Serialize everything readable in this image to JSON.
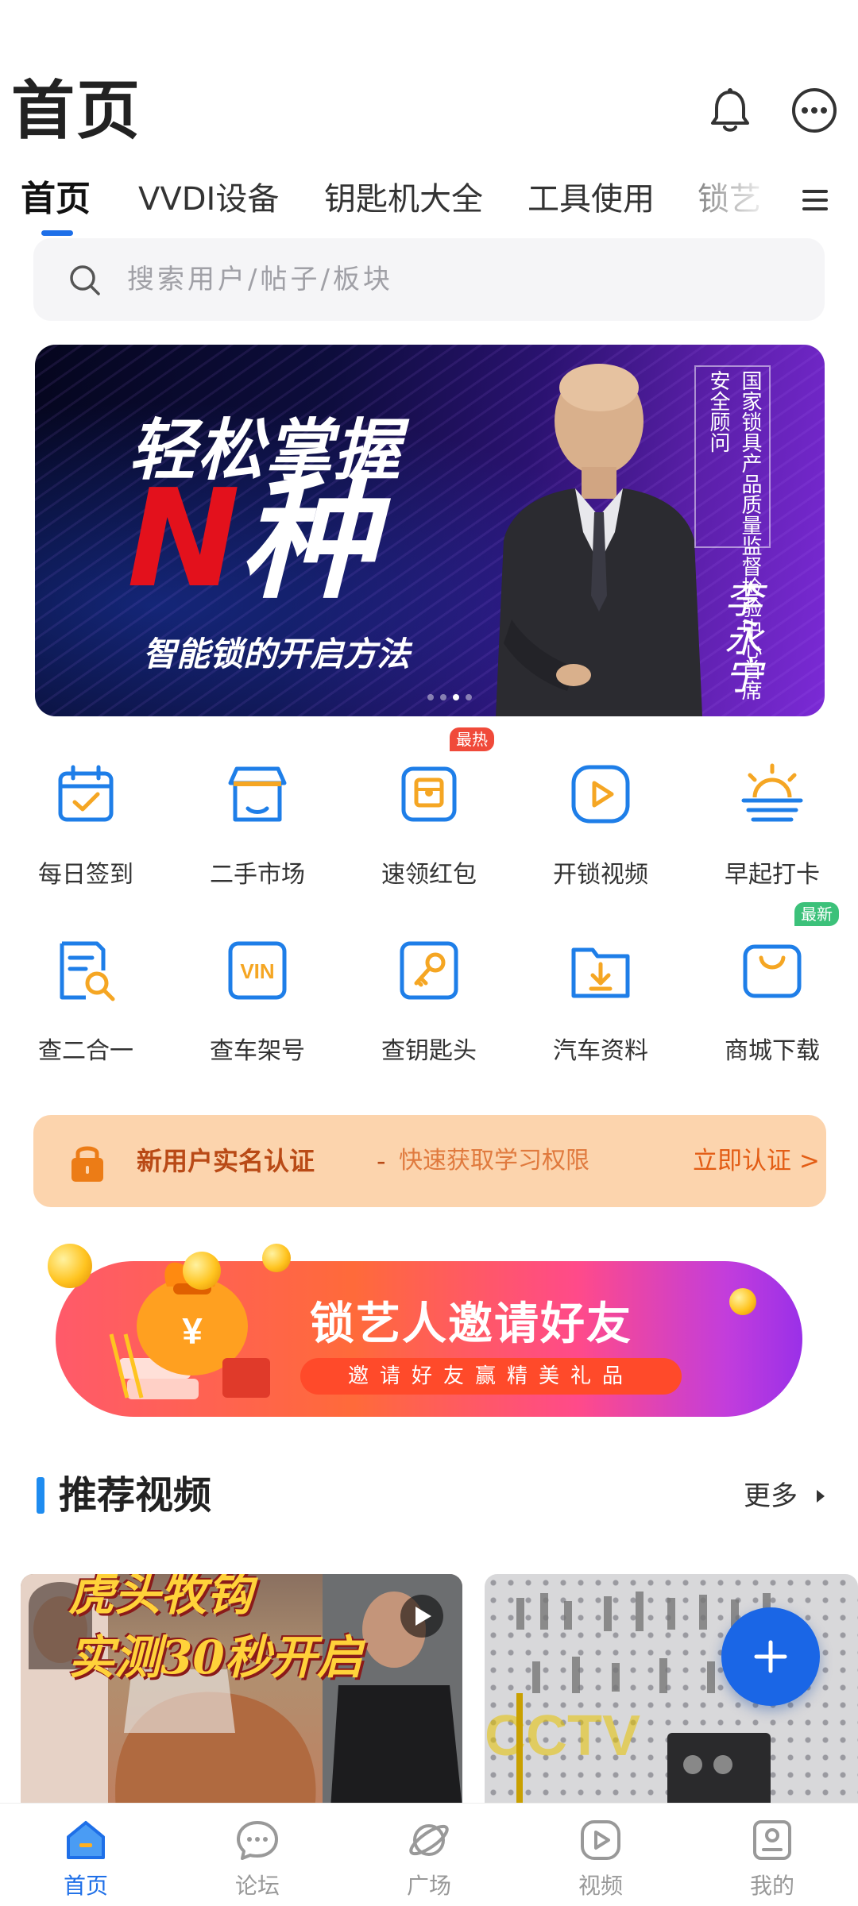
{
  "header": {
    "title": "首页",
    "bell_icon": "bell-icon",
    "more_icon": "more-icon"
  },
  "tabs": [
    {
      "label": "首页",
      "active": true
    },
    {
      "label": "VVDI设备",
      "active": false
    },
    {
      "label": "钥匙机大全",
      "active": false
    },
    {
      "label": "工具使用",
      "active": false
    },
    {
      "label": "锁艺",
      "active": false
    }
  ],
  "search": {
    "placeholder": "搜索用户/帖子/板块"
  },
  "banner": {
    "headline": "轻松掌握",
    "big_n": "N",
    "big_word": "种",
    "subtitle": "智能锁的开启方法",
    "vertical_caption": "国家锁具产品质量监督检验中心首席安全顾问",
    "signature": "李永宁",
    "slide_count": 4,
    "active_slide": 3
  },
  "quick_actions": [
    {
      "label": "每日签到",
      "icon": "calendar-check-icon",
      "badge": null
    },
    {
      "label": "二手市场",
      "icon": "shop-icon",
      "badge": null
    },
    {
      "label": "速领红包",
      "icon": "red-envelope-icon",
      "badge": "最热"
    },
    {
      "label": "开锁视频",
      "icon": "video-play-icon",
      "badge": null
    },
    {
      "label": "早起打卡",
      "icon": "sunrise-icon",
      "badge": null
    },
    {
      "label": "查二合一",
      "icon": "document-search-icon",
      "badge": null
    },
    {
      "label": "查车架号",
      "icon": "vin-icon",
      "badge": null
    },
    {
      "label": "查钥匙头",
      "icon": "key-icon",
      "badge": null
    },
    {
      "label": "汽车资料",
      "icon": "folder-download-icon",
      "badge": null
    },
    {
      "label": "商城下载",
      "icon": "shopping-bag-icon",
      "badge": "最新"
    }
  ],
  "badge_colors": {
    "hot": "#f04a3a",
    "new": "#3cc17a"
  },
  "verify": {
    "title": "新用户实名认证",
    "separator": "-",
    "desc": "快速获取学习权限",
    "cta": "立即认证 >"
  },
  "invite": {
    "title": "锁艺人邀请好友",
    "subtitle": "邀请好友赢精美礼品"
  },
  "recommend": {
    "title": "推荐视频",
    "more": "更多"
  },
  "videos": [
    {
      "line1": "虎头牧钩",
      "line2": "实测30秒开启"
    },
    {
      "watermark": "CCTV"
    }
  ],
  "bottom_nav": [
    {
      "label": "首页",
      "icon": "home-icon",
      "active": true
    },
    {
      "label": "论坛",
      "icon": "forum-icon",
      "active": false
    },
    {
      "label": "广场",
      "icon": "planet-icon",
      "active": false
    },
    {
      "label": "视频",
      "icon": "video-icon",
      "active": false
    },
    {
      "label": "我的",
      "icon": "profile-icon",
      "active": false
    }
  ],
  "colors": {
    "accent": "#1e6fe8",
    "icon_blue": "#1e7ee8",
    "icon_orange": "#f5a623",
    "verify_bg": "#fcd4ad",
    "verify_cta": "#e35d15"
  }
}
